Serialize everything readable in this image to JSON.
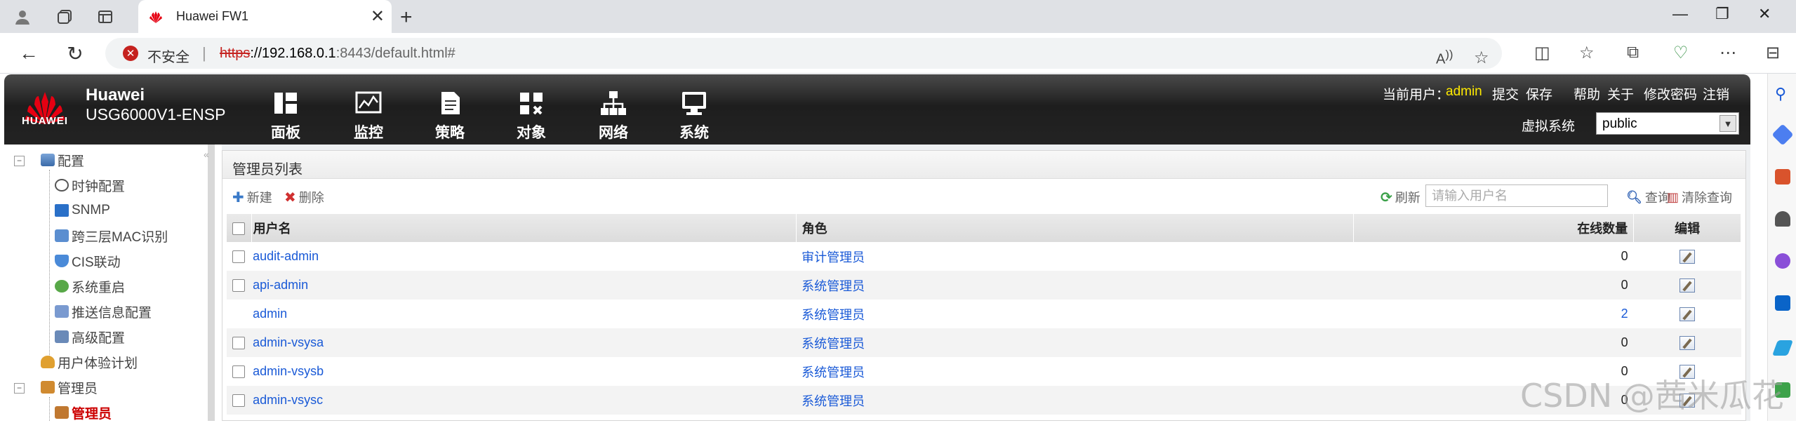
{
  "browser": {
    "tab_title": "Huawei FW1",
    "insecure_label": "不安全",
    "url_proto": "https",
    "url_host": "://192.168.0.1",
    "url_path": ":8443/default.html#"
  },
  "header": {
    "logo_text": "HUAWEI",
    "brand": "Huawei",
    "model": "USG6000V1-ENSP",
    "nav": [
      {
        "label": "面板",
        "icon": "dashboard-icon"
      },
      {
        "label": "监控",
        "icon": "monitor-icon"
      },
      {
        "label": "策略",
        "icon": "policy-icon"
      },
      {
        "label": "对象",
        "icon": "object-icon"
      },
      {
        "label": "网络",
        "icon": "network-icon"
      },
      {
        "label": "系统",
        "icon": "system-icon"
      }
    ],
    "current_user_label": "当前用户：",
    "current_user": "admin",
    "links": [
      "提交",
      "保存",
      "帮助",
      "关于",
      "修改密码",
      "注销"
    ],
    "vsys_label": "虚拟系统",
    "vsys_value": "public"
  },
  "tree": {
    "config_label": "配置",
    "config_items": [
      "时钟配置",
      "SNMP",
      "跨三层MAC识别",
      "CIS联动",
      "系统重启",
      "推送信息配置",
      "高级配置"
    ],
    "ux_plan": "用户体验计划",
    "admin_group": "管理员",
    "admin_item": "管理员"
  },
  "panel": {
    "title": "管理员列表",
    "new_label": "新建",
    "delete_label": "删除",
    "refresh_label": "刷新",
    "search_placeholder": "请输入用户名",
    "query_label": "查询",
    "clear_label": "清除查询"
  },
  "table": {
    "headers": {
      "username": "用户名",
      "role": "角色",
      "online": "在线数量",
      "edit": "编辑"
    },
    "rows": [
      {
        "user": "audit-admin",
        "role": "审计管理员",
        "online": "0",
        "checkbox": true
      },
      {
        "user": "api-admin",
        "role": "系统管理员",
        "online": "0",
        "checkbox": true
      },
      {
        "user": "admin",
        "role": "系统管理员",
        "online": "2",
        "checkbox": false
      },
      {
        "user": "admin-vsysa",
        "role": "系统管理员",
        "online": "0",
        "checkbox": true
      },
      {
        "user": "admin-vsysb",
        "role": "系统管理员",
        "online": "0",
        "checkbox": true
      },
      {
        "user": "admin-vsysc",
        "role": "系统管理员",
        "online": "0",
        "checkbox": true
      }
    ]
  },
  "watermark": "CSDN @茜米瓜花"
}
